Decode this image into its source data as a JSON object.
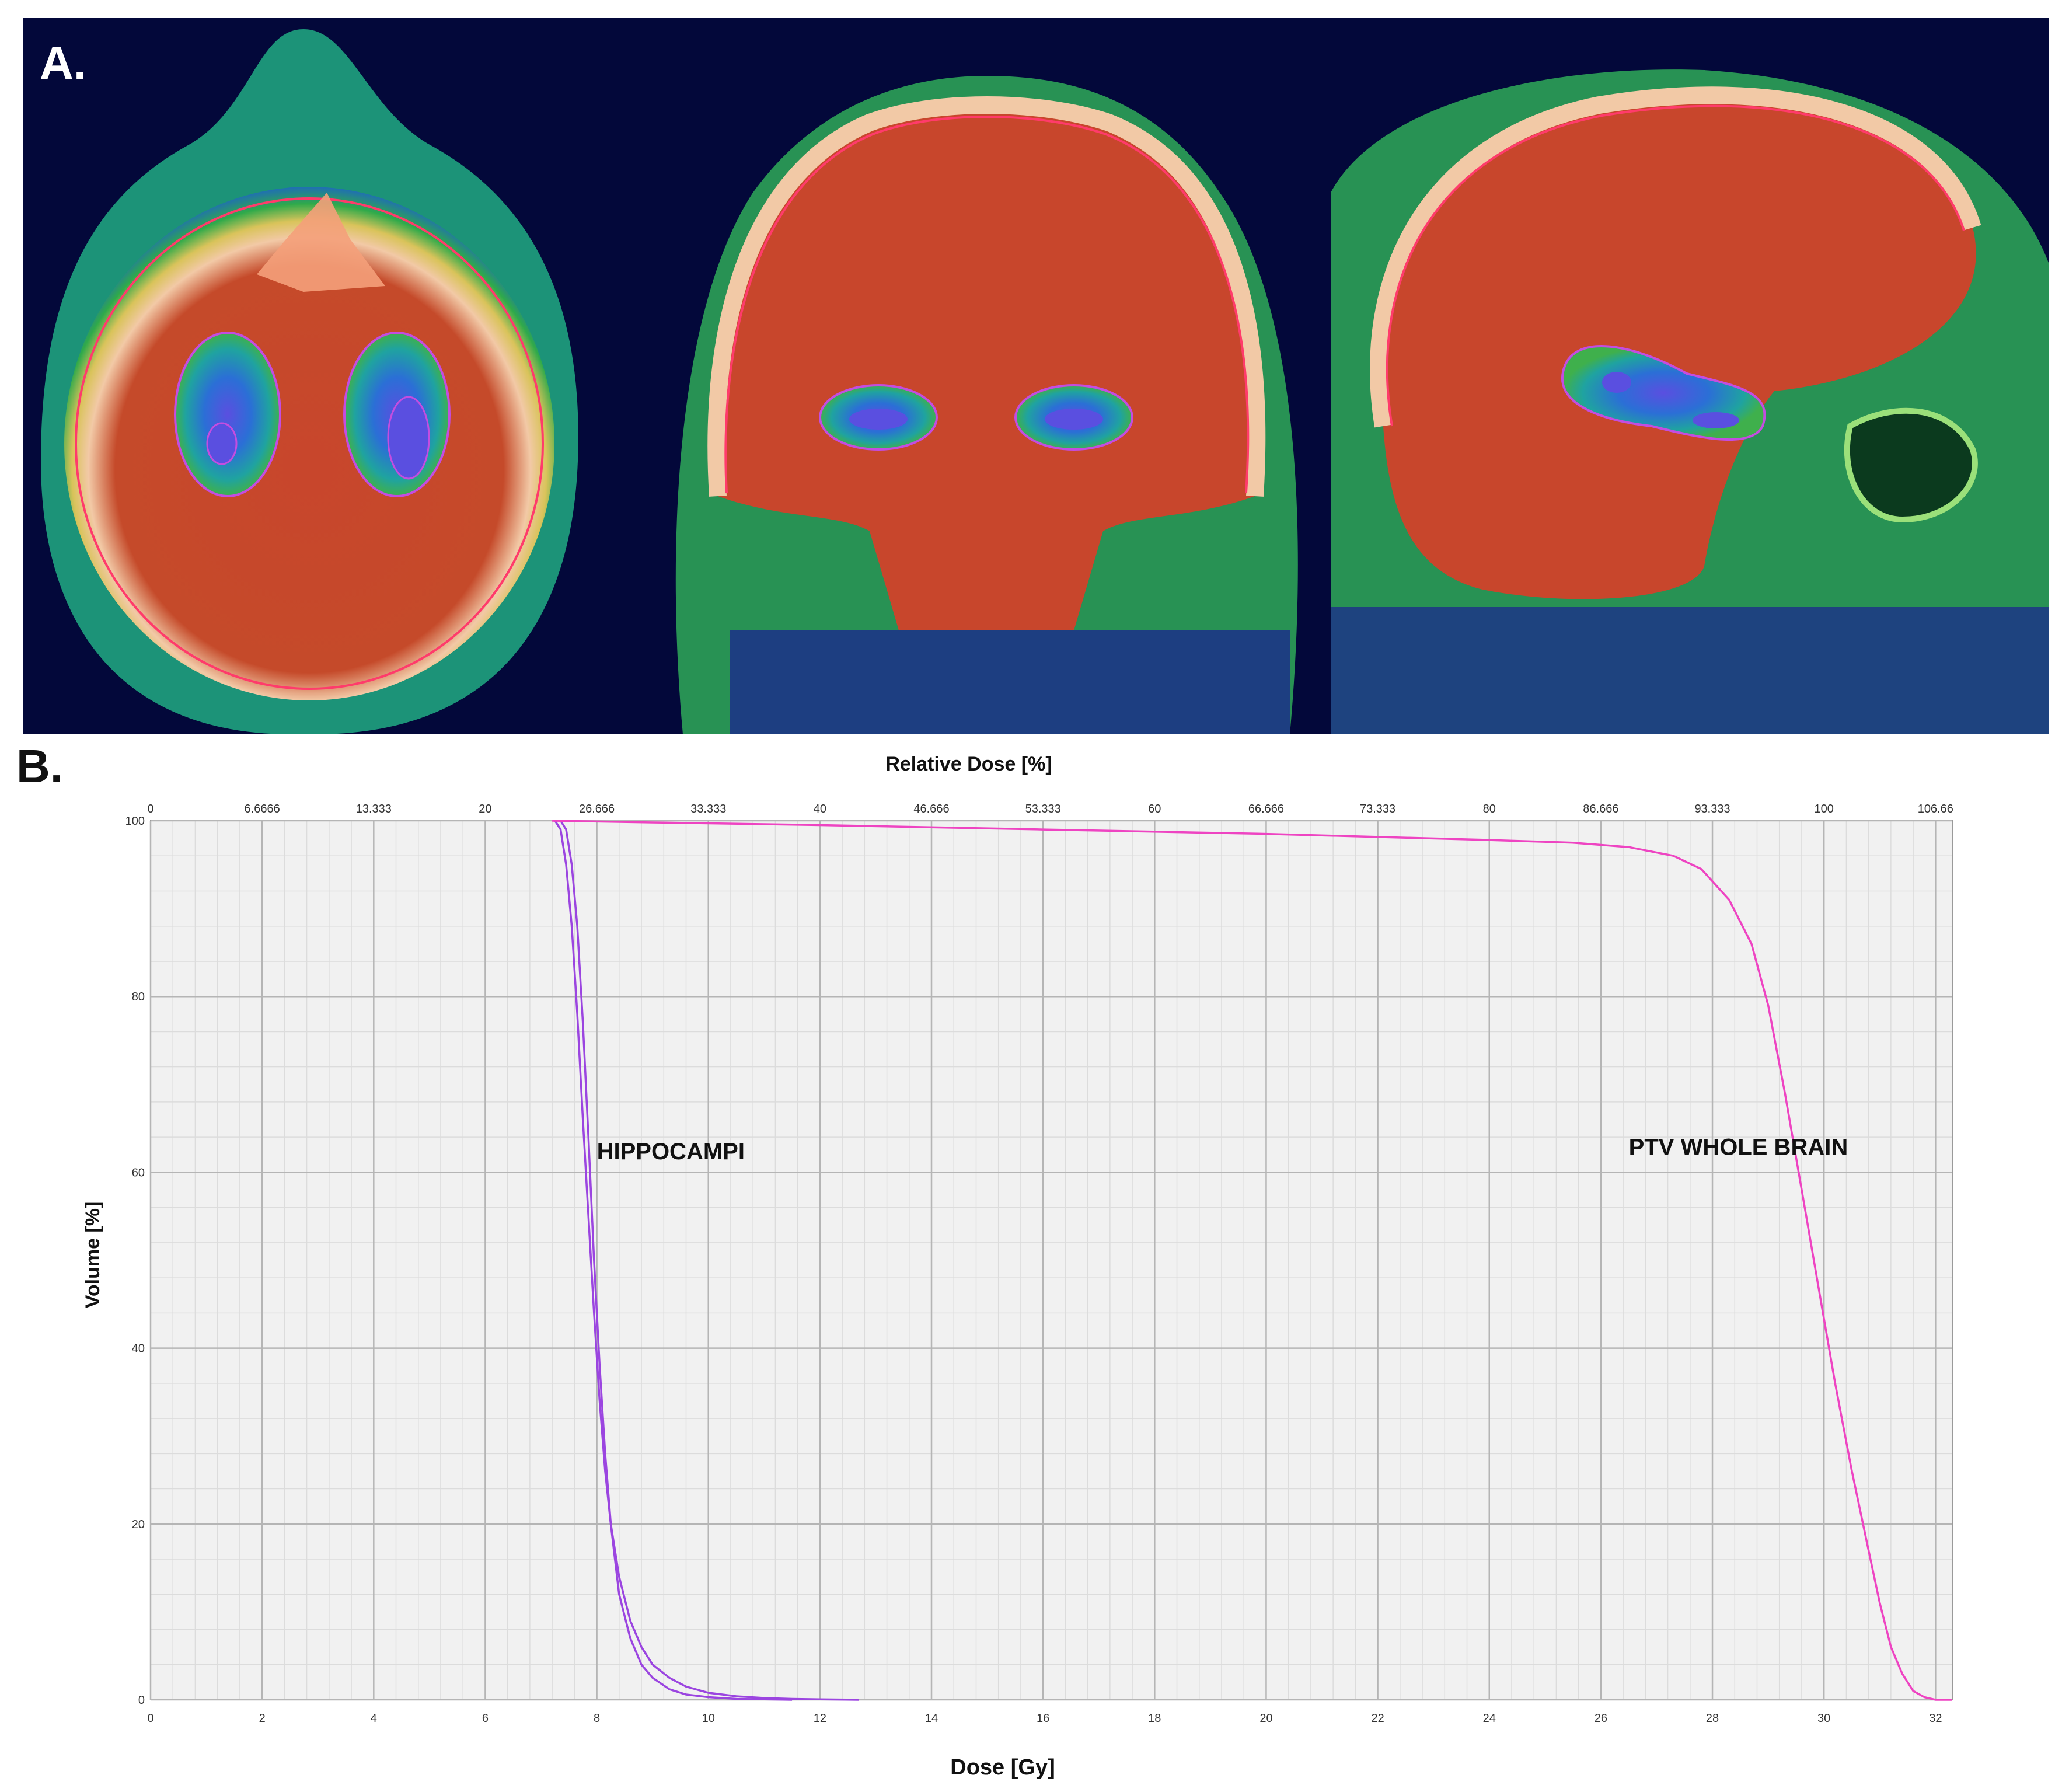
{
  "panel_a": {
    "label": "A.",
    "views": [
      {
        "name": "axial"
      },
      {
        "name": "coronal"
      },
      {
        "name": "sagittal"
      }
    ],
    "colors": {
      "background": "#03083a",
      "low_dose": "#1f6fb3",
      "mid_dose": "#2faa4a",
      "high_dose": "#c8462c",
      "outer_ring": "#f2c9a6",
      "ptv_contour": "#ff3b6b",
      "hippocampus_contour": "#c44de0",
      "hippocampus_core": "#5a4fe0"
    }
  },
  "panel_b": {
    "label": "B."
  },
  "chart_data": {
    "type": "line",
    "title": "",
    "xlabel": "Dose [Gy]",
    "ylabel": "Volume [%]",
    "top_xlabel": "Relative Dose [%]",
    "xlim": [
      0,
      32.3
    ],
    "ylim": [
      0,
      100
    ],
    "xticks": [
      0,
      2,
      4,
      6,
      8,
      10,
      12,
      14,
      16,
      18,
      20,
      22,
      24,
      26,
      28,
      30,
      32
    ],
    "yticks": [
      0,
      20,
      40,
      60,
      80,
      100
    ],
    "top_ticks": [
      {
        "dose": 0,
        "label": "0"
      },
      {
        "dose": 2,
        "label": "6.6666"
      },
      {
        "dose": 4,
        "label": "13.333"
      },
      {
        "dose": 6,
        "label": "20"
      },
      {
        "dose": 8,
        "label": "26.666"
      },
      {
        "dose": 10,
        "label": "33.333"
      },
      {
        "dose": 12,
        "label": "40"
      },
      {
        "dose": 14,
        "label": "46.666"
      },
      {
        "dose": 16,
        "label": "53.333"
      },
      {
        "dose": 18,
        "label": "60"
      },
      {
        "dose": 20,
        "label": "66.666"
      },
      {
        "dose": 22,
        "label": "73.333"
      },
      {
        "dose": 24,
        "label": "80"
      },
      {
        "dose": 26,
        "label": "86.666"
      },
      {
        "dose": 28,
        "label": "93.333"
      },
      {
        "dose": 30,
        "label": "100"
      },
      {
        "dose": 32,
        "label": "106.66"
      }
    ],
    "grid": true,
    "background": "#f1f1f1",
    "annotations": [
      {
        "text": "HIPPOCAMPI",
        "x": 8.0,
        "y": 61.5
      },
      {
        "text": "PTV WHOLE BRAIN",
        "x": 26.5,
        "y": 62
      }
    ],
    "series": [
      {
        "color": "#9b45e0",
        "x": [
          7.25,
          7.35,
          7.45,
          7.55,
          7.65,
          7.75,
          7.85,
          7.95,
          8.05,
          8.15,
          8.25,
          8.4,
          8.6,
          8.8,
          9.0,
          9.3,
          9.6,
          10.0,
          10.5,
          11.0,
          11.5,
          12.0,
          12.7
        ],
        "values": [
          100,
          99,
          95,
          88,
          78,
          66,
          55,
          44,
          34,
          26,
          20,
          14,
          9,
          6,
          4,
          2.5,
          1.5,
          0.8,
          0.4,
          0.2,
          0.1,
          0.05,
          0
        ]
      },
      {
        "color": "#9b45e0",
        "x": [
          7.35,
          7.45,
          7.55,
          7.65,
          7.75,
          7.85,
          7.95,
          8.05,
          8.15,
          8.25,
          8.4,
          8.6,
          8.8,
          9.0,
          9.3,
          9.6,
          10.0,
          10.5,
          11.0,
          11.5
        ],
        "values": [
          100,
          99,
          95,
          88,
          77,
          64,
          50,
          38,
          28,
          20,
          12,
          7,
          4,
          2.5,
          1.2,
          0.6,
          0.3,
          0.1,
          0.05,
          0
        ]
      },
      {
        "color": "#ee44c2",
        "x": [
          7.2,
          9,
          12,
          16,
          20,
          24,
          25.5,
          26.5,
          27.3,
          27.8,
          28.3,
          28.7,
          29.0,
          29.3,
          29.6,
          29.9,
          30.2,
          30.5,
          30.8,
          31.0,
          31.2,
          31.4,
          31.6,
          31.8,
          32.0,
          32.3
        ],
        "values": [
          100,
          99.8,
          99.5,
          99,
          98.5,
          97.8,
          97.5,
          97,
          96,
          94.5,
          91,
          86,
          79,
          69,
          58,
          47,
          36,
          26,
          17,
          11,
          6,
          3,
          1,
          0.3,
          0,
          0
        ]
      }
    ]
  }
}
